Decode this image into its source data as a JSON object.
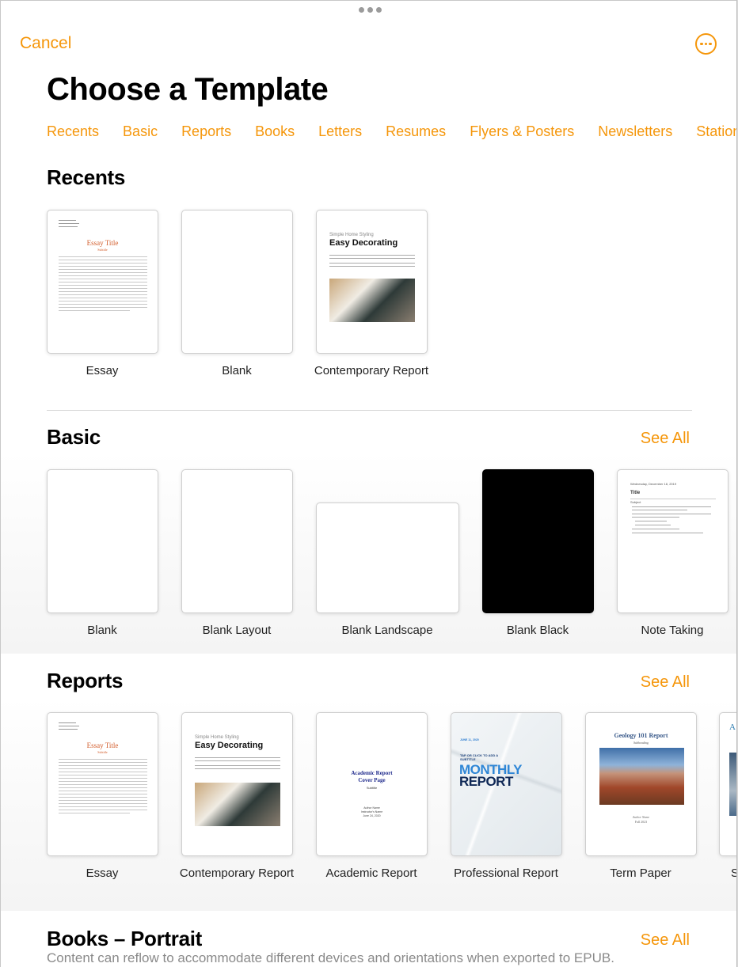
{
  "header": {
    "cancel_label": "Cancel",
    "more_icon": "ellipsis-circle-icon",
    "title": "Choose a Template"
  },
  "categories": [
    "Recents",
    "Basic",
    "Reports",
    "Books",
    "Letters",
    "Resumes",
    "Flyers & Posters",
    "Newsletters",
    "Stationery"
  ],
  "accent_color": "#f5960a",
  "sections": {
    "recents": {
      "title": "Recents",
      "items": [
        {
          "label": "Essay",
          "thumb": {
            "title": "Essay Title",
            "subtitle": "Subtitle"
          }
        },
        {
          "label": "Blank"
        },
        {
          "label": "Contemporary Report",
          "thumb": {
            "kicker": "Simple Home Styling",
            "title": "Easy Decorating"
          }
        }
      ]
    },
    "basic": {
      "title": "Basic",
      "see_all": "See All",
      "items": [
        {
          "label": "Blank"
        },
        {
          "label": "Blank Layout"
        },
        {
          "label": "Blank Landscape"
        },
        {
          "label": "Blank Black"
        },
        {
          "label": "Note Taking",
          "thumb": {
            "date": "Wednesday, December 18, 2019",
            "title": "Title",
            "subject": "Subject"
          }
        }
      ]
    },
    "reports": {
      "title": "Reports",
      "see_all": "See All",
      "items": [
        {
          "label": "Essay",
          "thumb": {
            "title": "Essay Title",
            "subtitle": "Subtitle"
          }
        },
        {
          "label": "Contemporary Report",
          "thumb": {
            "kicker": "Simple Home Styling",
            "title": "Easy Decorating"
          }
        },
        {
          "label": "Academic Report",
          "thumb": {
            "title_line1": "Academic Report",
            "title_line2": "Cover Page",
            "subtitle": "Subtitle",
            "author": "Author Name",
            "instructor": "Instructor's Name",
            "date": "June 24, 2020"
          }
        },
        {
          "label": "Professional Report",
          "thumb": {
            "date": "JUNE 11, 2020",
            "subtitle": "TAP OR CLICK TO ADD A SUBTITLE",
            "title_line1": "MONTHLY",
            "title_line2": "REPORT"
          }
        },
        {
          "label": "Term Paper",
          "thumb": {
            "title": "Geology 101 Report",
            "subtitle": "Subheading",
            "author": "Author Name",
            "date": "Fall 2023"
          }
        },
        {
          "label": "S",
          "thumb": {
            "title": "A"
          }
        }
      ]
    },
    "books_portrait": {
      "title": "Books – Portrait",
      "see_all": "See All",
      "description": "Content can reflow to accommodate different devices and orientations when exported to EPUB."
    }
  }
}
